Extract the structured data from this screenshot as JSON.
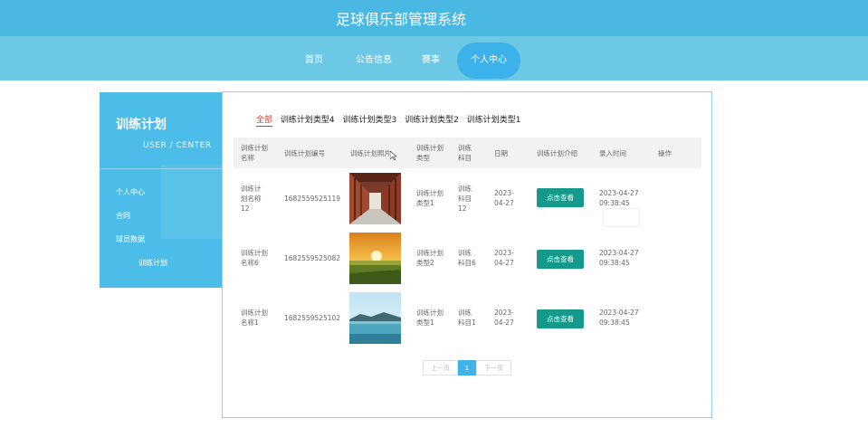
{
  "header": {
    "title": "足球俱乐部管理系统"
  },
  "nav": {
    "items": [
      "首页",
      "公告信息",
      "赛事",
      "个人中心"
    ]
  },
  "sidebar": {
    "title": "训练计划",
    "subtitle": "USER / CENTER",
    "items": [
      "个人中心",
      "合同",
      "球员数据",
      "训练计划"
    ]
  },
  "filter_tabs": [
    "全部",
    "训练计划类型4",
    "训练计划类型3",
    "训练计划类型2",
    "训练计划类型1"
  ],
  "table": {
    "headers": [
      "训练计划名称",
      "训练计划编号",
      "训练计划照片",
      "训练计划类型",
      "训练科目",
      "日期",
      "训练计划介绍",
      "录入时间",
      "操作"
    ],
    "rows": [
      {
        "name": "训练计划名称12",
        "code": "1682559525119",
        "photo": "corridor-photo",
        "type": "训练计划类型1",
        "subject": "训练科目12",
        "date": "2023-04-27",
        "intro": "点击查看",
        "time": "2023-04-27 09:38:45"
      },
      {
        "name": "训练计划名称6",
        "code": "1682559525082",
        "photo": "sunset-field-photo",
        "type": "训练计划类型2",
        "subject": "训练科目6",
        "date": "2023-04-27",
        "intro": "点击查看",
        "time": "2023-04-27 09:38:45"
      },
      {
        "name": "训练计划名称1",
        "code": "1682559525102",
        "photo": "lake-photo",
        "type": "训练计划类型1",
        "subject": "训练科目1",
        "date": "2023-04-27",
        "intro": "点击查看",
        "time": "2023-04-27 09:38:45"
      }
    ]
  },
  "pagination": {
    "prev": "上一页",
    "current": "1",
    "next": "下一页"
  },
  "colors": {
    "header": "#49b8e3",
    "nav": "#6dc8e6",
    "sidebar": "#4cbde8",
    "button": "#15998a",
    "active_tab": "#e0362c"
  }
}
